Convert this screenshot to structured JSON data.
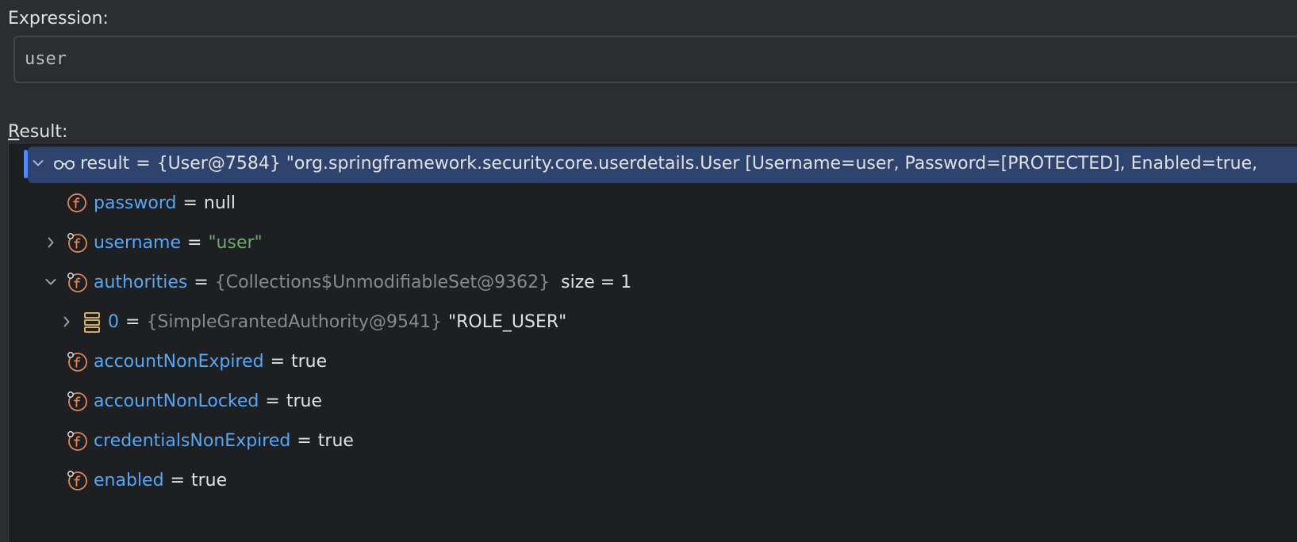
{
  "expression": {
    "label": "Expression:",
    "value": "user"
  },
  "result": {
    "label_first": "R",
    "label_rest": "esult:"
  },
  "tree": {
    "root": {
      "name": "result",
      "eq": "=",
      "value": "{User@7584} \"org.springframework.security.core.userdetails.User [Username=user, Password=[PROTECTED], Enabled=true,",
      "icon": "watch-glasses-icon",
      "expanded": true
    },
    "fields": [
      {
        "name": "password",
        "eq": "=",
        "value": "null",
        "value_style": "plain",
        "icon": "field-icon",
        "expandable": false
      },
      {
        "name": "username",
        "eq": "=",
        "value": "\"user\"",
        "value_style": "string",
        "icon": "field-final-icon",
        "expandable": true,
        "expanded": false
      },
      {
        "name": "authorities",
        "eq": "=",
        "type": "{Collections$UnmodifiableSet@9362}",
        "extra": "size = 1",
        "icon": "field-final-icon",
        "expandable": true,
        "expanded": true
      },
      {
        "name": "accountNonExpired",
        "eq": "=",
        "value": "true",
        "value_style": "plain",
        "icon": "field-final-icon",
        "expandable": false
      },
      {
        "name": "accountNonLocked",
        "eq": "=",
        "value": "true",
        "value_style": "plain",
        "icon": "field-final-icon",
        "expandable": false
      },
      {
        "name": "credentialsNonExpired",
        "eq": "=",
        "value": "true",
        "value_style": "plain",
        "icon": "field-final-icon",
        "expandable": false
      },
      {
        "name": "enabled",
        "eq": "=",
        "value": "true",
        "value_style": "plain",
        "icon": "field-final-icon",
        "expandable": false
      }
    ],
    "authority_item": {
      "name": "0",
      "eq": "=",
      "type": "{SimpleGrantedAuthority@9541}",
      "value": "\"ROLE_USER\"",
      "icon": "array-element-icon",
      "expandable": true,
      "expanded": false
    }
  },
  "colors": {
    "background": "#2b2d30",
    "tree_background": "#1e1f22",
    "selection": "#2e436e",
    "field_name": "#56a8f5",
    "string_value": "#6aab73",
    "type_text": "#868a91",
    "field_icon": "#e0885a",
    "element_icon": "#e8c06a"
  }
}
